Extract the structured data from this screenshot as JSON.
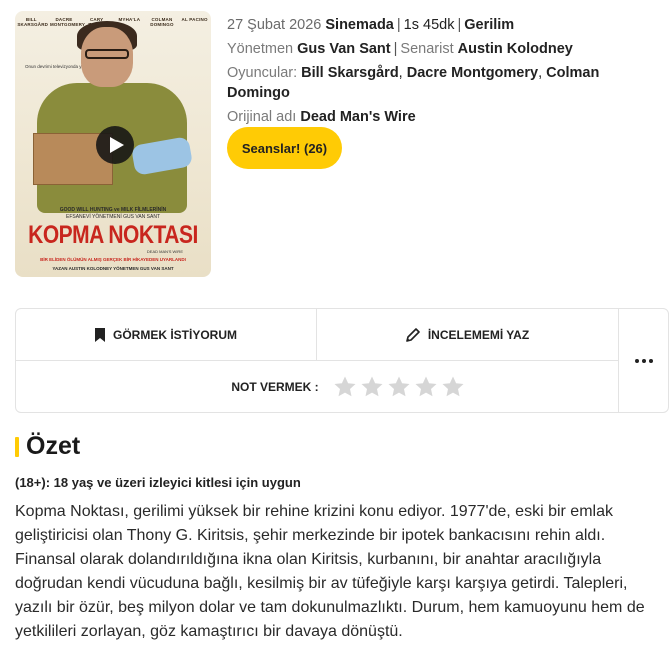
{
  "poster": {
    "cast_names": [
      "BILL SKARSGÅRD",
      "DACRE MONTGOMERY",
      "CARY ELWES",
      "MYHA'LA",
      "COLMAN DOMINGO",
      "AL PACINO"
    ],
    "tagline": "Onun devrimi televizyonda yayınlandı.",
    "credit_line1": "GOOD WILL HUNTING ve MILK FİLMLERİNİN",
    "credit_line2": "EFSANEVİ YÖNETMENİ GUS VAN SANT",
    "title": "KOPMA NOKTASI",
    "orig_title": "DEAD MAN'S WIRE",
    "line": "BİR ELİDEN ÖLÜMÜN ALMIŞ GERÇEK BİR HİKAYEDEN UYARLANDI",
    "bottom": "YAZAN AUSTIN KOLODNEY  YÖNETMEN GUS VAN SANT",
    "play_icon": "play-icon"
  },
  "info": {
    "date": "27 Şubat 2026",
    "status": "Sinemada",
    "duration": "1s 45dk",
    "genre": "Gerilim",
    "director_label": "Yönetmen",
    "director": "Gus Van Sant",
    "writer_label": "Senarist",
    "writer": "Austin Kolodney",
    "cast_label": "Oyuncular:",
    "cast": [
      "Bill Skarsgård",
      "Dacre Montgomery",
      "Colman Domingo"
    ],
    "original_label": "Orijinal adı",
    "original_title": "Dead Man's Wire"
  },
  "sessions_button": "Seanslar! (26)",
  "actions": {
    "watchlist_label": "GÖRMEK İSTİYORUM",
    "review_label": "İNCELEMEMİ YAZ",
    "rate_label": "NOT VERMEK :",
    "star_count": 5,
    "icons": {
      "watchlist": "bookmark-icon",
      "review": "pen-icon",
      "more": "more-icon",
      "star": "star-icon"
    }
  },
  "summary": {
    "title": "Özet",
    "age_rating": "(18+): 18 yaş ve üzeri izleyici kitlesi için uygun",
    "description": "Kopma Noktası, gerilimi yüksek bir rehine krizini konu ediyor. 1977'de, eski bir emlak geliştiricisi olan Thony G. Kiritsis, şehir merkezinde bir ipotek bankacısını rehin aldı. Finansal olarak dolandırıldığına ikna olan Kiritsis, kurbanını, bir anahtar aracılığıyla doğrudan kendi vücuduna bağlı, kesilmiş bir av tüfeğiyle karşı karşıya getirdi. Talepleri, yazılı bir özür, beş milyon dolar ve tam dokunulmazlıktı. Durum, hem kamuoyunu hem de yetkilileri zorlayan, göz kamaştırıcı bir davaya dönüştü."
  },
  "colors": {
    "accent": "#ffcb05",
    "poster_title": "#c8261e",
    "star": "#d6d6d6"
  }
}
